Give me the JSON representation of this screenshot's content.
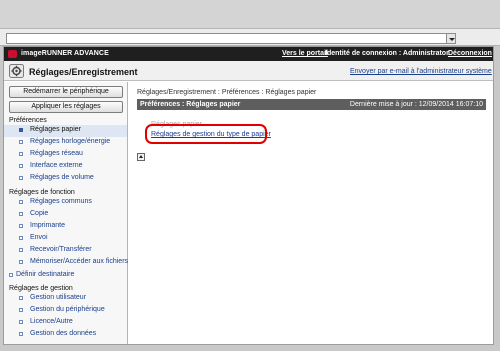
{
  "header": {
    "brand": "imageRUNNER ADVANCE",
    "portal_link": "Vers le portail",
    "login_info": "Identité de connexion : Administrator",
    "logout_link": "Déconnexion",
    "accent_color": "#c8102e"
  },
  "title_bar": {
    "title": "Réglages/Enregistrement",
    "icon": "settings-icon",
    "email_link": "Envoyer par e-mail à l'administrateur système"
  },
  "sidebar": {
    "restart_button": "Redémarrer le périphérique",
    "apply_button": "Appliquer les réglages",
    "preferences_header": "Préférences",
    "preferences_items": [
      {
        "label": "Réglages papier",
        "active": true
      },
      {
        "label": "Réglages horloge/énergie"
      },
      {
        "label": "Réglages réseau"
      },
      {
        "label": "Interface externe"
      },
      {
        "label": "Réglages de volume"
      }
    ],
    "function_header": "Réglages de fonction",
    "function_items": [
      {
        "label": "Réglages communs"
      },
      {
        "label": "Copie"
      },
      {
        "label": "Imprimante"
      },
      {
        "label": "Envoi"
      },
      {
        "label": "Recevoir/Transférer"
      },
      {
        "label": "Mémoriser/Accéder aux fichiers"
      }
    ],
    "define_destination": "Définir destinataire",
    "management_header": "Réglages de gestion",
    "management_items": [
      {
        "label": "Gestion utilisateur"
      },
      {
        "label": "Gestion du périphérique"
      },
      {
        "label": "Licence/Autre"
      },
      {
        "label": "Gestion des données"
      }
    ]
  },
  "main": {
    "breadcrumb": "Réglages/Enregistrement : Préférences : Réglages papier",
    "section_title": "Préférences : Réglages papier",
    "last_update": "Dernière mise à jour : 12/09/2014 16:07:10",
    "faded_item": "Réglages papier",
    "paper_type_link": "Réglages de gestion du type de papier"
  }
}
